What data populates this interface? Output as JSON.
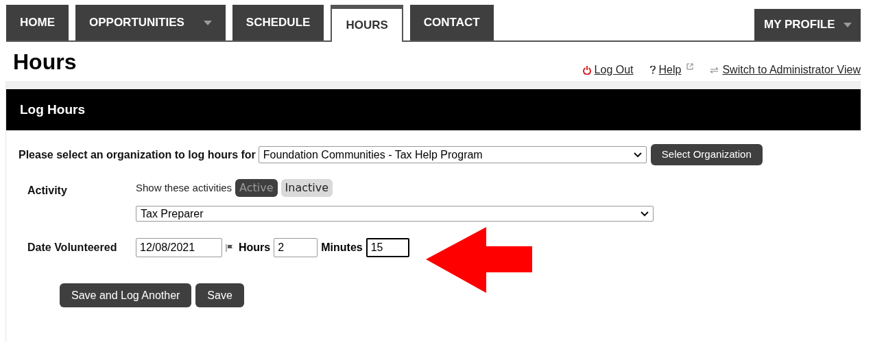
{
  "nav_tabs": [
    {
      "label": "HOME",
      "selected": false,
      "dropdown": false
    },
    {
      "label": "OPPORTUNITIES",
      "selected": false,
      "dropdown": true
    },
    {
      "label": "SCHEDULE",
      "selected": false,
      "dropdown": false
    },
    {
      "label": "HOURS",
      "selected": true,
      "dropdown": false
    },
    {
      "label": "CONTACT",
      "selected": false,
      "dropdown": false
    }
  ],
  "profile_menu": {
    "label": "MY PROFILE"
  },
  "page_title": "Hours",
  "header_links": [
    {
      "kind": "logout",
      "label": "Log Out"
    },
    {
      "kind": "help",
      "label": "Help"
    },
    {
      "kind": "switch",
      "label": "Switch to Administrator View"
    }
  ],
  "panel": {
    "title": "Log Hours",
    "organization": {
      "label": "Please select an organization to log hours for",
      "value": "Foundation Communities - Tax Help Program",
      "button": "Select Organization"
    },
    "activity": {
      "label": "Activity",
      "filter_label": "Show these activities",
      "filters": [
        {
          "label": "Active",
          "selected": true
        },
        {
          "label": "Inactive",
          "selected": false
        }
      ],
      "value": "Tax Preparer"
    },
    "date": {
      "label": "Date Volunteered",
      "value": "12/08/2021"
    },
    "hours": {
      "label": "Hours",
      "value": "2"
    },
    "minutes": {
      "label": "Minutes",
      "value": "15",
      "focused": true
    },
    "buttons": [
      "Save and Log Another",
      "Save"
    ]
  }
}
